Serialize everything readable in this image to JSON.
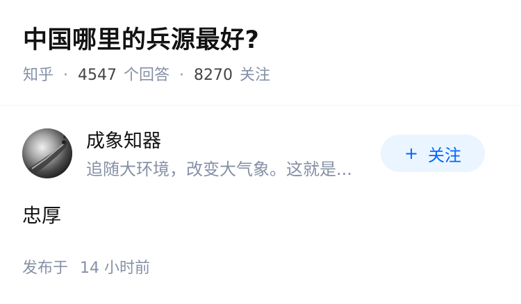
{
  "question": {
    "title": "中国哪里的兵源最好?",
    "source": "知乎",
    "separator": "·",
    "answer_count": "4547",
    "answer_label": "个回答",
    "follower_count": "8270",
    "follower_label": "关注"
  },
  "answer": {
    "author": {
      "name": "成象知器",
      "headline": "追随大环境，改变大气象。这就是..."
    },
    "follow_button": {
      "icon": "plus-icon",
      "plus": "+",
      "label": "关注",
      "accent_color": "#0066ff",
      "background": "#ebf5ff"
    },
    "content": "忠厚",
    "published_label": "发布于",
    "published_time": "14 小时前"
  }
}
